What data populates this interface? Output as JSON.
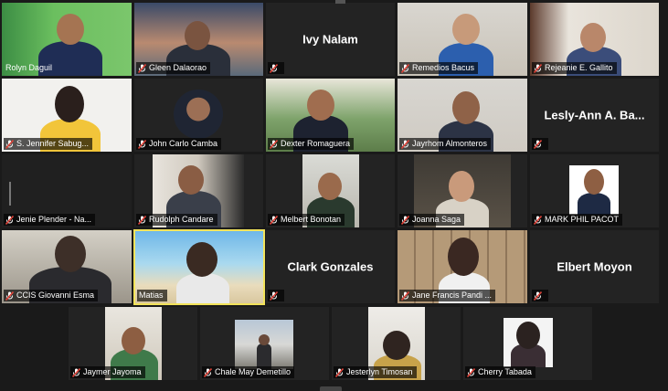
{
  "participants": [
    {
      "name": "Rolyn Daguil"
    },
    {
      "name": "Gleen Dalaorao"
    },
    {
      "name": "Ivy Nalam"
    },
    {
      "name": "Remedios Bacus"
    },
    {
      "name": "Rejeanie E. Gallito"
    },
    {
      "name": "S. Jennifer Sabug..."
    },
    {
      "name": "John Carlo Camba"
    },
    {
      "name": "Dexter Romaguera"
    },
    {
      "name": "Jayrhom Almonteros"
    },
    {
      "name": "Lesly-Ann A. Ba..."
    },
    {
      "name": "Jenie Plender - Na..."
    },
    {
      "name": "Rudolph Candare"
    },
    {
      "name": "Melbert Bonotan"
    },
    {
      "name": "Joanna Saga"
    },
    {
      "name": "MARK PHIL PACOT"
    },
    {
      "name": "CCIS Giovanni Esma"
    },
    {
      "name": "Matias"
    },
    {
      "name": "Clark Gonzales"
    },
    {
      "name": "Jane Francis Pandi ..."
    },
    {
      "name": "Elbert Moyon"
    },
    {
      "name": "Jaymer Jayoma"
    },
    {
      "name": "Chale May Demetillo"
    },
    {
      "name": "Jesterlyn Timosan"
    },
    {
      "name": "Cherry Tabada"
    }
  ],
  "colors": {
    "active_speaker_border": "#f2e35a",
    "mute_icon": "#e0443a",
    "tile_bg": "#232323"
  }
}
